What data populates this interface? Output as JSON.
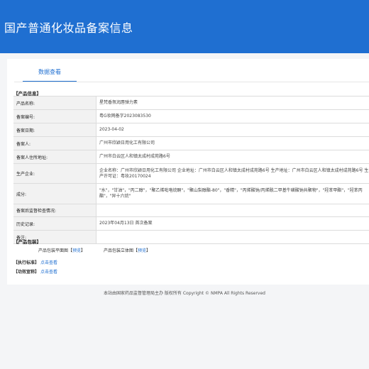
{
  "header": {
    "title": "国产普通化妆品备案信息"
  },
  "tabs": [
    {
      "label": "数据查看"
    }
  ],
  "product_info": {
    "section_title": "【产品信息】",
    "rows": [
      {
        "label": "产品名称:",
        "value": "星梵香氛润唇弹力素"
      },
      {
        "label": "备案编号:",
        "value": "粤G妆网备字2023083530"
      },
      {
        "label": "备案日期:",
        "value": "2023-04-02"
      },
      {
        "label": "备案人:",
        "value": "广州市欣颖日用化工有限公司"
      },
      {
        "label": "备案人住所地址:",
        "value": "广州市白云区人和镇太成村成苑路6号"
      },
      {
        "label": "生产企业:",
        "value": "企业名称：广州市欣颖日用化工有限公司 企业地址：广州市白云区人和镇太成村成苑路6号 生产地址：广州市白云区人和镇太成村成苑路6号 生产许可证：粤妆20170024"
      },
      {
        "label": "成分:",
        "value": "\"水\"，\"甘油\"，\"丙二醇\"，\"聚乙烯吡咯烷酮\"，\"聚山梨醇酯-80\"，\"香精\"，\"丙烯酸钠/丙烯酰二甲基牛磺酸钠共聚物\"，\"羟苯甲酯\"，\"羟苯丙酯\"，\"异十六烷\""
      },
      {
        "label": "备案后监督检查情况:",
        "value": ""
      },
      {
        "label": "历史记录:",
        "value": "2023年04月13日 首次备案"
      },
      {
        "label": "备注:",
        "value": ""
      }
    ]
  },
  "packaging": {
    "section_title": "【产品包装】",
    "flat_label": "产品包装平面图",
    "solid_label": "产品包装立体图",
    "bracket_open": "【",
    "bracket_close": "】",
    "preview_label": "预览"
  },
  "standard": {
    "section_title": "【执行标准】",
    "link": "点击查看"
  },
  "efficacy": {
    "section_title": "【功效宣称】",
    "link": "点击查看"
  },
  "footer": {
    "text": "本站由国家药品监督管理局主办 版权所有 Copyright © NMPA All Rights Reserved"
  },
  "colors": {
    "brand": "#1f6fd1"
  }
}
